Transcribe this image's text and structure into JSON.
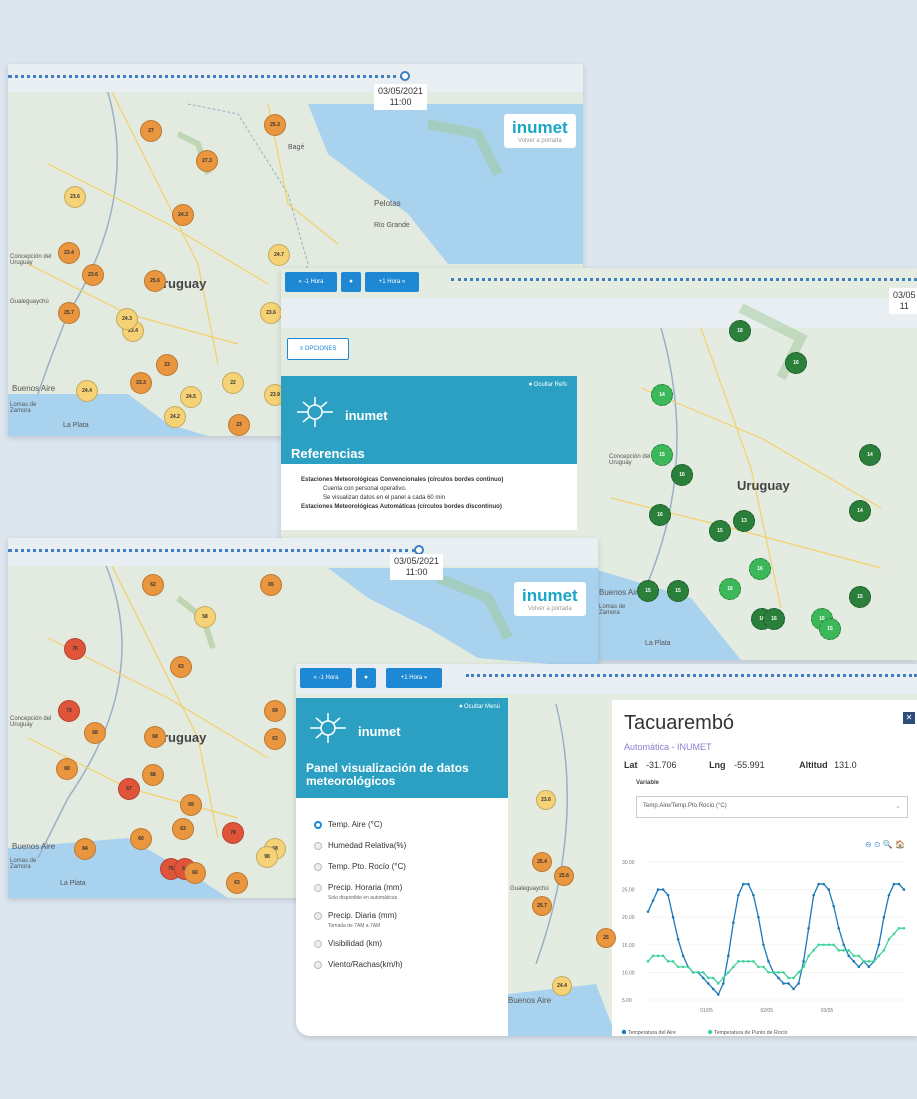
{
  "colors": {
    "page_bg": "#dde6ef",
    "accent": "#1e88d4",
    "brand": "#2ba0c3",
    "temp_line": "#1d7ab8",
    "dew_line": "#3ed39a",
    "green_dot": "#2a7f3a",
    "orange_dot": "#e9963f",
    "yellow_dot": "#f6d276",
    "red_dot": "#e0553a"
  },
  "map1": {
    "timeline_date": "03/05/2021",
    "timeline_time": "11:00",
    "logo": "inumet",
    "logo_sub": "Volver a portada",
    "labels": {
      "country": "ruguay",
      "concepcion": "Concepción del Uruguay",
      "gualeguaychu": "Gualeguaychú",
      "buenos_aires": "Buenos Aire",
      "lomas": "Lomas de Zamora",
      "la_plata": "La Plata",
      "pelotas": "Pelotas",
      "rio_grande": "Rio Grande",
      "bage": "Bagé"
    },
    "dots": [
      "27",
      "25.3",
      "27.3",
      "23.6",
      "24.3",
      "23.4",
      "23.6",
      "24.7",
      "25.6",
      "25.7",
      "23.4",
      "24.3",
      "23.6",
      "23",
      "23.3",
      "24.4",
      "24.5",
      "22",
      "23.9",
      "24.2",
      "23"
    ]
  },
  "map2": {
    "btn_prev": "« -1 Hora",
    "btn_center": "⏺",
    "btn_next": "+1 Hora »",
    "timeline_date": "03/05",
    "timeline_time": "11",
    "opciones": "≡ OPCIONES",
    "hide": "⏺ Ocultar Refs",
    "logo": "inumet",
    "referencias": "Referencias",
    "refs": [
      "Estaciones Meteorológicas Convencionales (círculos bordes continuo)",
      "Cuenta con personal operativo.",
      "Se visualizan datos en el panel a cada 60 min",
      "Estaciones Meteorológicas Automáticas (círculos bordes discontinuo)"
    ],
    "labels": {
      "country": "Uruguay",
      "concepcion": "Concepción del Uruguay",
      "buenos_aires": "Buenos Aire",
      "lomas": "Lomas de Zamora",
      "la_plata": "La Plata"
    },
    "dots": [
      "18",
      "16",
      "14",
      "15",
      "16",
      "14",
      "16",
      "14",
      "13",
      "15",
      "16",
      "16",
      "15",
      "15",
      "15",
      "16",
      "16",
      "16",
      "15"
    ]
  },
  "map3": {
    "timeline_date": "03/05/2021",
    "timeline_time": "11:00",
    "logo": "inumet",
    "logo_sub": "Volver a portada",
    "labels": {
      "country": "ruguay",
      "concepcion": "Concepción del Uruguay",
      "buenos_aires": "Buenos Aire",
      "lomas": "Lomas de Zamora",
      "la_plata": "La Plata"
    },
    "dots": [
      "62",
      "65",
      "58",
      "76",
      "63",
      "69",
      "73",
      "68",
      "68",
      "63",
      "69",
      "68",
      "57",
      "78",
      "69",
      "60",
      "63",
      "68",
      "76",
      "64",
      "60",
      "63",
      "84",
      "98"
    ]
  },
  "panel4": {
    "btn_prev": "« -1 Hora",
    "btn_center": "⏺",
    "btn_next": "+1 Hora »",
    "hide": "⏺ Ocultar Menú",
    "logo": "inumet",
    "title": "Panel visualización de datos meteorológicos",
    "options": [
      {
        "label": "Temp. Aire (°C)",
        "selected": true,
        "note": ""
      },
      {
        "label": "Humedad Relativa(%)",
        "selected": false,
        "note": ""
      },
      {
        "label": "Temp. Pto. Rocío (°C)",
        "selected": false,
        "note": ""
      },
      {
        "label": "Precip. Horaria (mm)",
        "selected": false,
        "note": "Solo disponible en automáticas"
      },
      {
        "label": "Precip. Diaria (mm)",
        "selected": false,
        "note": "Tomada de 7AM a 7AM"
      },
      {
        "label": "Visibilidad (km)",
        "selected": false,
        "note": ""
      },
      {
        "label": "Viento/Rachas(km/h)",
        "selected": false,
        "note": ""
      }
    ],
    "map_dots": [
      "23.6",
      "25.4",
      "25.6",
      "25.7",
      "24.4",
      "25"
    ],
    "map_label_buenos_aires": "Buenos Aire",
    "map_label_gualeguaychu": "Gualeguaychú"
  },
  "station": {
    "name": "Tacuarembó",
    "type": "Automática - INUMET",
    "lat_label": "Lat",
    "lat": "-31.706",
    "lng_label": "Lng",
    "lng": "-55.991",
    "alt_label": "Altitud",
    "alt": "131.0",
    "variable_label": "Variable",
    "variable_value": "Temp.Aire/Temp.Pto.Rocío (°C)",
    "close": "✕",
    "chart_tools": "⊖ ⊙ 🔍 🏠"
  },
  "chart_data": {
    "type": "line",
    "title": "",
    "yticks": [
      "30.00",
      "25.00",
      "20.00",
      "15.00",
      "10.00",
      "5.00"
    ],
    "xticks": [
      "01/05",
      "02/05",
      "03/05"
    ],
    "ylim": [
      5,
      30
    ],
    "x_hours": [
      0,
      2,
      4,
      6,
      8,
      10,
      12,
      14,
      16,
      18,
      20,
      22,
      24,
      26,
      28,
      30,
      32,
      34,
      36,
      38,
      40,
      42,
      44,
      46,
      48,
      50,
      52,
      54,
      56,
      58,
      60,
      62,
      64,
      66,
      68,
      70,
      72,
      74,
      76,
      78,
      80,
      82,
      84,
      86,
      88,
      90,
      92,
      94,
      96,
      98,
      100,
      102
    ],
    "series": [
      {
        "name": "Temperatura del Aire",
        "color": "#1d7ab8",
        "values": [
          21,
          23,
          25,
          25,
          24,
          20,
          16,
          13,
          11,
          10,
          10,
          9,
          8,
          7,
          6,
          8,
          13,
          19,
          24,
          26,
          26,
          24,
          20,
          15,
          12,
          10,
          9,
          8,
          8,
          7,
          8,
          12,
          18,
          24,
          26,
          26,
          25,
          22,
          18,
          15,
          13,
          12,
          11,
          12,
          11,
          12,
          15,
          20,
          24,
          26,
          26,
          25
        ]
      },
      {
        "name": "Temperatura de Punto de Rocío",
        "color": "#3ed39a",
        "values": [
          12,
          13,
          13,
          13,
          12,
          12,
          11,
          11,
          11,
          10,
          10,
          10,
          9,
          9,
          8,
          9,
          10,
          11,
          12,
          12,
          12,
          12,
          11,
          11,
          10,
          10,
          10,
          10,
          9,
          9,
          10,
          11,
          13,
          14,
          15,
          15,
          15,
          15,
          14,
          14,
          14,
          13,
          13,
          12,
          12,
          12,
          13,
          14,
          16,
          17,
          18,
          18
        ]
      }
    ]
  }
}
